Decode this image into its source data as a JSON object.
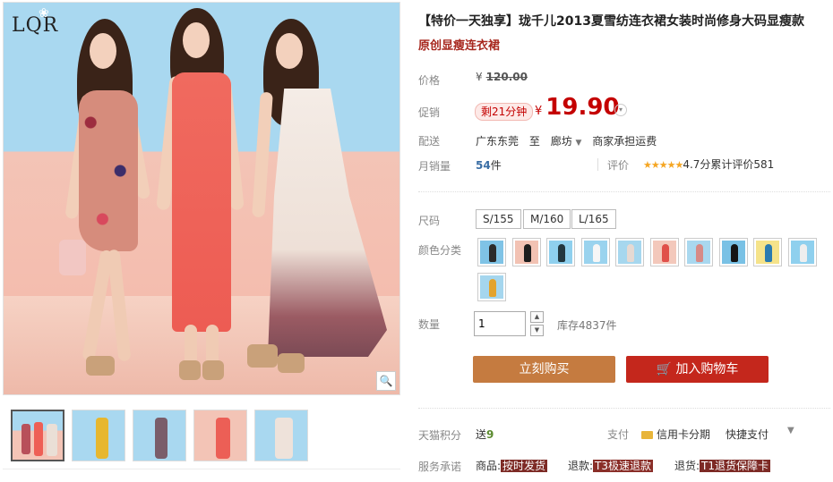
{
  "gallery": {
    "logo": "LQR",
    "thumb_count": 5
  },
  "product": {
    "title": "【特价一天独享】珑千儿2013夏雪纺连衣裙女装时尚修身大码显瘦款",
    "subtitle": "原创显瘦连衣裙"
  },
  "price": {
    "label": "价格",
    "currency": "¥",
    "original": "120.00"
  },
  "promo": {
    "label": "促销",
    "countdown": "剩21分钟",
    "currency": "¥",
    "value": "19.90"
  },
  "shipping": {
    "label": "配送",
    "from": "广东东莞",
    "to_word": "至",
    "destination": "廊坊",
    "fee": "商家承担运费"
  },
  "sales": {
    "label": "月销量",
    "count": "54",
    "unit": "件",
    "rating_label": "评价",
    "stars": "★★★★★",
    "rating_text": "4.7分累计评价581"
  },
  "size": {
    "label": "尺码",
    "options": [
      "S/155",
      "M/160",
      "L/165"
    ]
  },
  "color": {
    "label": "颜色分类",
    "options": [
      {
        "bg": "#7fc3e6",
        "fig": "#2b2b2b"
      },
      {
        "bg": "#f2c2b3",
        "fig": "#1d1d1d"
      },
      {
        "bg": "#8fd0ee",
        "fig": "#23373f"
      },
      {
        "bg": "#9ad3ee",
        "fig": "#f6f6f6"
      },
      {
        "bg": "#a6d7ee",
        "fig": "#e6d9d2"
      },
      {
        "bg": "#f3c8bb",
        "fig": "#e0504a"
      },
      {
        "bg": "#a9d8ef",
        "fig": "#d78a86"
      },
      {
        "bg": "#79c1e5",
        "fig": "#151515"
      },
      {
        "bg": "#f5e38a",
        "fig": "#2a7bb0"
      },
      {
        "bg": "#8fd0ee",
        "fig": "#eeeeee"
      },
      {
        "bg": "#a5d6ee",
        "fig": "#e3a32d"
      }
    ]
  },
  "quantity": {
    "label": "数量",
    "value": "1",
    "stock": "库存4837件"
  },
  "actions": {
    "buy_now": "立刻购买",
    "add_cart": "加入购物车"
  },
  "extras": {
    "points_label": "天猫积分",
    "points_prefix": "送",
    "points_value": "9",
    "pay_label": "支付",
    "pay_credit": "信用卡分期",
    "pay_quick": "快捷支付",
    "service_label": "服务承诺",
    "svc1_prefix": "商品:",
    "svc1_tag": "按时发货",
    "svc2_prefix": "退款:",
    "svc2_tag": "T3极速退款",
    "svc3_prefix": "退货:",
    "svc3_tag": "T1退货保障卡"
  }
}
